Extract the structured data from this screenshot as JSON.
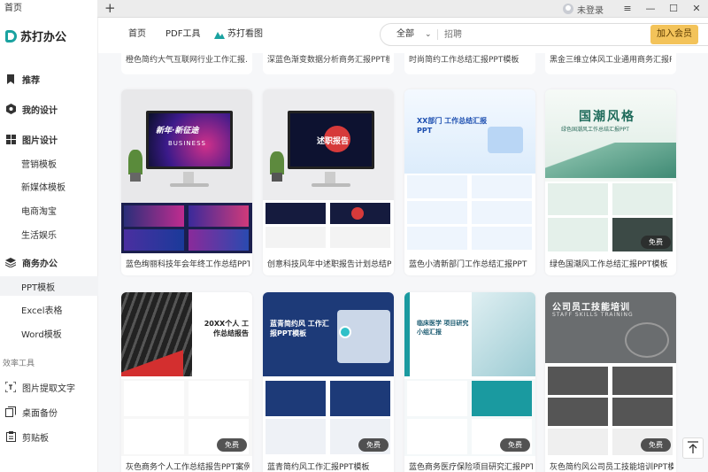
{
  "tabbar": {
    "tab_title": "首页",
    "add_label": "+",
    "user_label": "未登录",
    "menu_icon": "≡",
    "min_icon": "—",
    "max_icon": "☐",
    "close_icon": "✕"
  },
  "brand": {
    "name": "苏打办公",
    "color": "#1aa2a0"
  },
  "sidebar": {
    "recommend": "推荐",
    "my_design": "我的设计",
    "image_design": "图片设计",
    "marketing": "营销模板",
    "new_media": "新媒体模板",
    "ecommerce": "电商淘宝",
    "life": "生活娱乐",
    "business": "商务办公",
    "ppt": "PPT模板",
    "excel": "Excel表格",
    "word": "Word模板",
    "tools_group": "效率工具",
    "ocr": "图片提取文字",
    "backup": "桌面备份",
    "clipboard": "剪贴板"
  },
  "topnav": {
    "home": "首页",
    "pdf": "PDF工具",
    "kantu": "苏打看图"
  },
  "search": {
    "category": "全部",
    "placeholder": "招聘"
  },
  "vip_button": "加入会员",
  "accent_vip": "#f3c35a",
  "top_row": [
    "橙色简约大气互联网行业工作汇报...",
    "深蓝色渐变数据分析商务汇报PPT模...",
    "时尚简约工作总结汇报PPT模板",
    "黑金三维立体风工业通用商务汇报PPT..."
  ],
  "badge_free": "免费",
  "cards": [
    {
      "title": "蓝色绚丽科技年会年终工作总结PPT...",
      "thumb_text": "新年·新征途",
      "thumb_sub": "BUSINESS",
      "free": false
    },
    {
      "title": "创意科技风年中述职报告计划总结PPT...",
      "thumb_text": "述职报告",
      "free": false
    },
    {
      "title": "蓝色小清新部门工作总结汇报PPT",
      "thumb_text": "XX部门 工作总结汇报PPT",
      "free": false
    },
    {
      "title": "绿色国潮风工作总结汇报PPT模板",
      "thumb_text": "国潮风格",
      "thumb_sub": "绿色国潮风工作总结汇报PPT",
      "free": true
    },
    {
      "title": "灰色商务个人工作总结报告PPT案例",
      "thumb_text": "20XX个人 工作总结报告",
      "free": true
    },
    {
      "title": "蓝青简约风工作汇报PPT模板",
      "thumb_text": "蓝青简约风 工作汇报PPT模板",
      "free": true
    },
    {
      "title": "蓝色商务医疗保险项目研究汇报PPT模板",
      "thumb_text": "临床医学 项目研究小组汇报",
      "free": true
    },
    {
      "title": "灰色简约风公司员工技能培训PPT模...",
      "thumb_text": "公司员工技能培训",
      "thumb_sub": "STAFF SKILLS TRAINING",
      "free": true
    }
  ]
}
